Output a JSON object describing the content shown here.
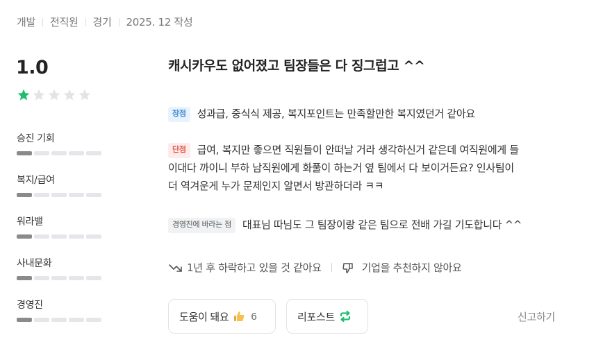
{
  "meta": {
    "job": "개발",
    "status": "전직원",
    "location": "경기",
    "date": "2025. 12 작성"
  },
  "rating": {
    "score": "1.0",
    "stars_filled": 1,
    "stars_total": 5,
    "star_color": "#1fbf6e"
  },
  "metrics": [
    {
      "label": "승진 기회",
      "level": 1
    },
    {
      "label": "복지/급여",
      "level": 1
    },
    {
      "label": "워라밸",
      "level": 1
    },
    {
      "label": "사내문화",
      "level": 1
    },
    {
      "label": "경영진",
      "level": 1
    }
  ],
  "review": {
    "title": "캐시카우도 없어졌고 팀장들은 다 징그럽고 ^^",
    "pros_tag": "장점",
    "pros_text": "성과급, 중식식 제공, 복지포인트는 만족할만한 복지였던거 같아요",
    "cons_tag": "단점",
    "cons_lines": [
      "급여, 복지만 좋으면 직원들이 안떠날 거라 생각하신거 같은데 여직원에게 들",
      "이대다 까이니 부하 남직원에게 화풀이 하는거 옆 팀에서 다 보이거든요? 인사팀이",
      "더 역겨운게 누가 문제인지 알면서 방관하더라 ㅋㅋ"
    ],
    "wish_tag": "경영진에 바라는 점",
    "wish_text": "대표님 따님도 그 팀장이랑 같은 팀으로 전배 가길 기도합니다 ^^"
  },
  "outlook": {
    "growth": "1년 후 하락하고 있을 것 같아요",
    "recommend": "기업을 추천하지 않아요"
  },
  "actions": {
    "helpful_label": "도움이 돼요",
    "helpful_count": "6",
    "repost_label": "리포스트",
    "report_label": "신고하기"
  }
}
